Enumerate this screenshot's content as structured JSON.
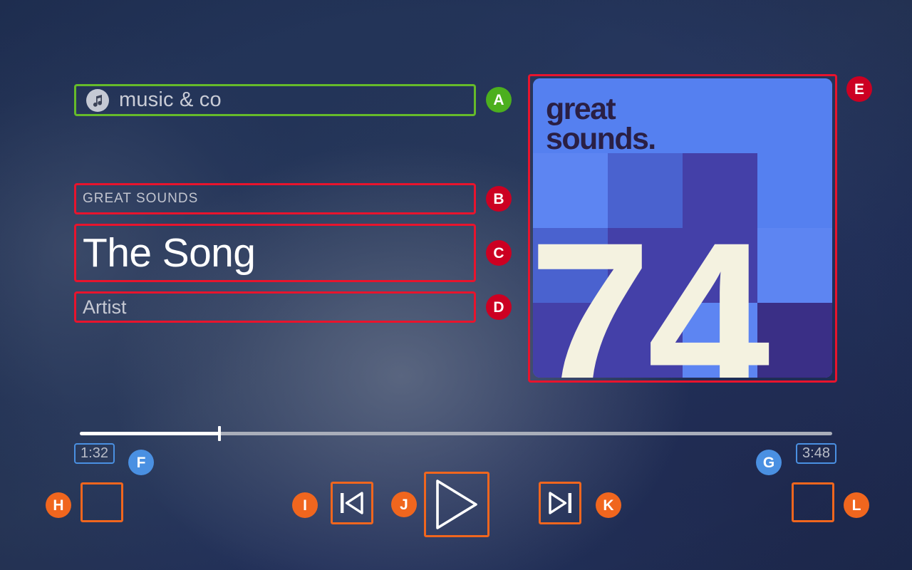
{
  "app": {
    "name": "music & co",
    "icon": "music-note-icon"
  },
  "now_playing": {
    "album_label": "GREAT SOUNDS",
    "track_title": "The Song",
    "artist": "Artist"
  },
  "artwork": {
    "brand_line1": "great",
    "brand_line2": "sounds.",
    "number": "74",
    "colors": {
      "base": "#5580f0",
      "light": "#5d85f2",
      "mid": "#4a62cf",
      "dark": "#4440a8",
      "deep": "#3a2f86",
      "text": "#2a1f44",
      "numeral": "#f4f2e0"
    },
    "tiles": [
      "base",
      "base",
      "base",
      "base",
      "light",
      "mid",
      "dark",
      "base",
      "mid",
      "dark",
      "dark",
      "light",
      "dark",
      "dark",
      "light",
      "deep"
    ]
  },
  "progress": {
    "elapsed": "1:32",
    "total": "3:48",
    "percent": 18.6
  },
  "controls": {
    "shuffle": "shuffle-button",
    "previous": "previous-track-button",
    "play": "play-button",
    "next": "next-track-button",
    "repeat": "repeat-button"
  },
  "annotations": {
    "a": {
      "letter": "A",
      "color": "#4caf1e",
      "target": "app-name-field"
    },
    "b": {
      "letter": "B",
      "color": "#cc0022",
      "target": "album-label"
    },
    "c": {
      "letter": "C",
      "color": "#cc0022",
      "target": "track-title"
    },
    "d": {
      "letter": "D",
      "color": "#cc0022",
      "target": "artist-name"
    },
    "e": {
      "letter": "E",
      "color": "#cc0022",
      "target": "album-artwork"
    },
    "f": {
      "letter": "F",
      "color": "#4a90e2",
      "target": "elapsed-time"
    },
    "g": {
      "letter": "G",
      "color": "#4a90e2",
      "target": "total-time"
    },
    "h": {
      "letter": "H",
      "color": "#f0661e",
      "target": "shuffle-button"
    },
    "i": {
      "letter": "I",
      "color": "#f0661e",
      "target": "previous-button"
    },
    "j": {
      "letter": "J",
      "color": "#f0661e",
      "target": "play-button"
    },
    "k": {
      "letter": "K",
      "color": "#f0661e",
      "target": "next-button"
    },
    "l": {
      "letter": "L",
      "color": "#f0661e",
      "target": "repeat-button"
    }
  }
}
